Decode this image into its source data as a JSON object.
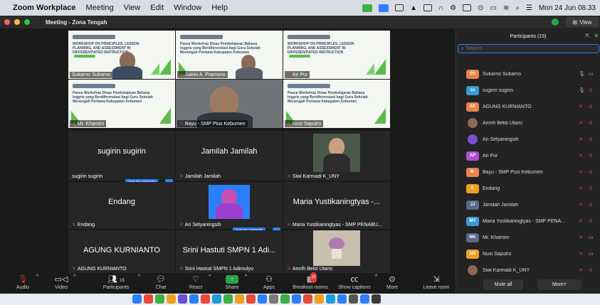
{
  "menubar": {
    "app": "Zoom Workplace",
    "items": [
      "Meeting",
      "View",
      "Edit",
      "Window",
      "Help"
    ],
    "datetime": "Mon 24 Jun 08.33"
  },
  "window": {
    "title": "Meeting - Zona Tengah",
    "view_label": "View"
  },
  "tiles": {
    "t1": "Sukarno Sukarno",
    "t2": "Satrio A. Pramono",
    "t3": "Ari Pur",
    "t4": "Mr. Khamim",
    "t5": "Bayu - SMP Pius Kebumen",
    "t6": "Nusi Saputro",
    "slide_title_a": "WORKSHOP ON PRINCIPLES, LESSON PLANNING, AND ASSESSMENT IN DIFFERENTIATED INSTRUCTION",
    "slide_title_b": "Pasca Workshop Dinas Pembelajaran Bahasa Inggris yang Berdiferensiasi bagi Guru Sekolah Menengah Pertama Kabupaten Kebumen",
    "slide_date": "22 JUNI 2024",
    "r1a_big": "sugirin sugirin",
    "r1a_small": "sugirin sugirin",
    "r1b_big": "Jamilah Jamilah",
    "r1b_small": "Jamilah Jamilah",
    "r1c_small": "Siwi Karmadi K_UNY",
    "ask1": "Ask to unmute",
    "r2a_big": "Endang",
    "r2a_small": "Endang",
    "r2b_small": "Ari Setyaningsih",
    "r2c_big": "Maria Yustikaningtyas -...",
    "r2c_small": "Maria Yustikaningtyas - SMP PENABU...",
    "ask2": "Ask to unmute",
    "r3a_big": "AGUNG KURNIANTO",
    "r3a_small": "AGUNG KURNIANTO",
    "r3b_big": "Srini Hastuti SMPN 1 Adi...",
    "r3b_small": "Srini Hastuti SMPN 1 Adimulyo",
    "r3c_small": "Amrih Bekti Utami",
    "dots": "···"
  },
  "toolbar": {
    "audio": "Audio",
    "video": "Video",
    "participants": "Participants",
    "participants_count": "15",
    "chat": "Chat",
    "react": "React",
    "share": "Share",
    "apps": "Apps",
    "breakout": "Breakout rooms",
    "captions": "Show captions",
    "more": "More",
    "leave": "Leave room",
    "badge": "29"
  },
  "participants_panel": {
    "header": "Participants (15)",
    "search_placeholder": "Search",
    "list": [
      {
        "initials": "SS",
        "name": "Sukarno Sukarno",
        "color": "#e8834a",
        "mic": "on",
        "cam": "on"
      },
      {
        "initials": "ss",
        "name": "sugirin sugirin",
        "color": "#3a9bd9",
        "mic": "on",
        "cam": "off"
      },
      {
        "initials": "AK",
        "name": "AGUNG KURNIANTO",
        "color": "#e8834a",
        "mic": "off",
        "cam": "off"
      },
      {
        "initials": "",
        "name": "Amrih Bekti Utami",
        "color": "#8a6a55",
        "mic": "off",
        "cam": "off"
      },
      {
        "initials": "",
        "name": "Ari Setyaningsih",
        "color": "#7a4fd0",
        "mic": "off",
        "cam": "off"
      },
      {
        "initials": "AP",
        "name": "Ari Pur",
        "color": "#b04fd0",
        "mic": "off",
        "cam": "off"
      },
      {
        "initials": "B-",
        "name": "Bayu - SMP Pius Kebumen",
        "color": "#e8834a",
        "mic": "off",
        "cam": "off"
      },
      {
        "initials": "E",
        "name": "Endang",
        "color": "#f0a020",
        "mic": "off",
        "cam": "off"
      },
      {
        "initials": "JJ",
        "name": "Jamilah Jamilah",
        "color": "#5a6a8a",
        "mic": "off",
        "cam": "off"
      },
      {
        "initials": "MY",
        "name": "Maria Yustikaningtyas - SMP PENA...",
        "color": "#3a9bd9",
        "mic": "off",
        "cam": "off"
      },
      {
        "initials": "MK",
        "name": "Mr. Khamim",
        "color": "#5a6a8a",
        "mic": "off",
        "cam": "on"
      },
      {
        "initials": "NS",
        "name": "Nusi Saputro",
        "color": "#f0a020",
        "mic": "off",
        "cam": "on"
      },
      {
        "initials": "",
        "name": "Siwi Karmadi K_UNY",
        "color": "#8a6a55",
        "mic": "off",
        "cam": "off"
      }
    ],
    "mute_all": "Mute all",
    "more": "More"
  }
}
